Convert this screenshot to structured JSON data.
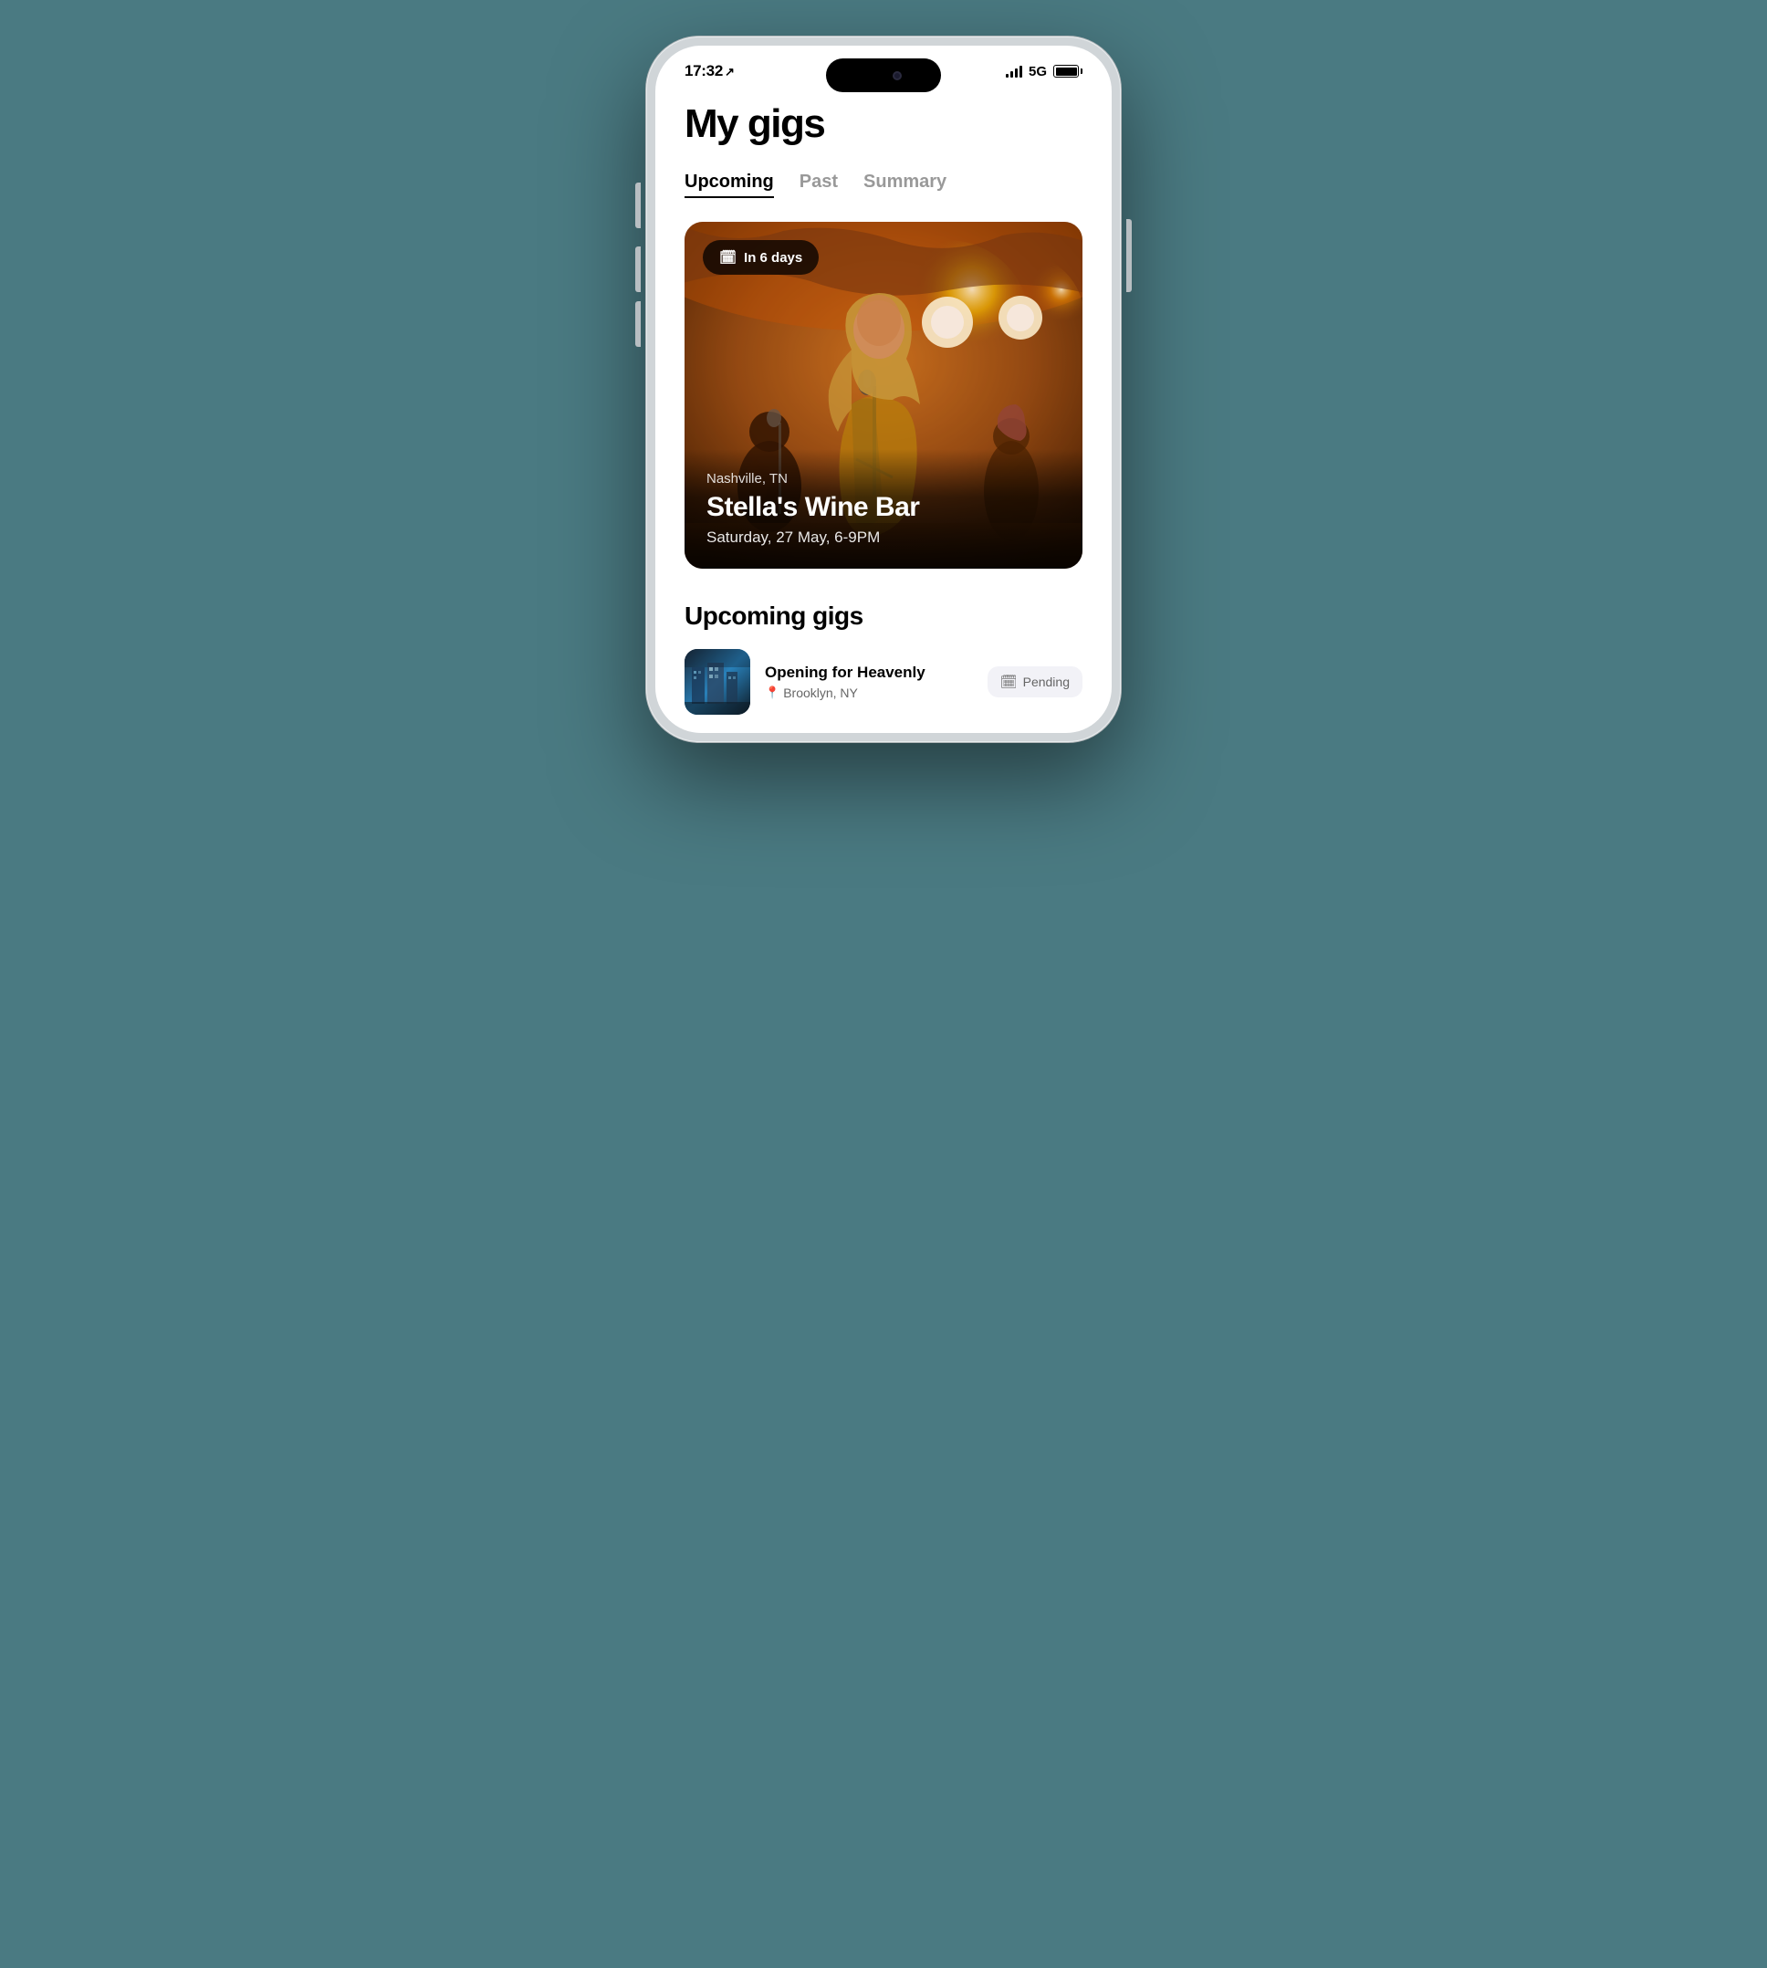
{
  "status_bar": {
    "time": "17:32",
    "time_arrow": "➤",
    "network": "5G",
    "battery_level": "100"
  },
  "page": {
    "title": "My gigs"
  },
  "tabs": [
    {
      "id": "upcoming",
      "label": "Upcoming",
      "active": true
    },
    {
      "id": "past",
      "label": "Past",
      "active": false
    },
    {
      "id": "summary",
      "label": "Summary",
      "active": false
    }
  ],
  "hero_card": {
    "badge_icon": "📅",
    "badge_text": "In 6 days",
    "location": "Nashville, TN",
    "venue": "Stella's Wine Bar",
    "date": "Saturday, 27 May, 6-9PM"
  },
  "upcoming_section": {
    "title": "Upcoming gigs",
    "items": [
      {
        "name": "Opening for Heavenly",
        "location": "Brooklyn, NY",
        "status": "Pending",
        "status_icon": "📅"
      }
    ]
  },
  "icons": {
    "calendar": "🗓",
    "location_pin": "📍",
    "pending_calendar": "🗓"
  }
}
